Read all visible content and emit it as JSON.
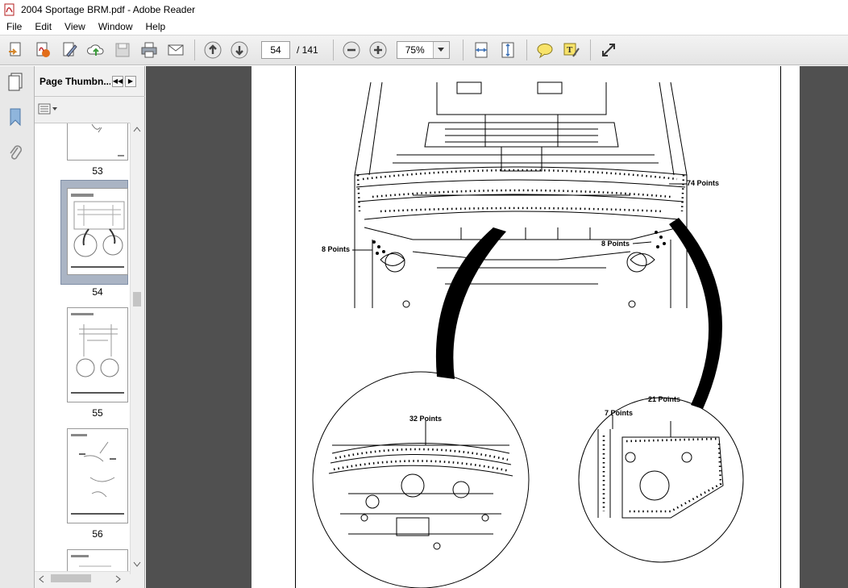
{
  "window": {
    "title": "2004 Sportage BRM.pdf - Adobe Reader"
  },
  "menu": [
    "File",
    "Edit",
    "View",
    "Window",
    "Help"
  ],
  "toolbar": {
    "page_current": "54",
    "page_total": "/ 141",
    "zoom": "75%"
  },
  "thumbnails": {
    "title": "Page Thumbn...",
    "pages": [
      "53",
      "54",
      "55",
      "56"
    ],
    "selected": "54"
  },
  "drawing": {
    "callouts": {
      "top_right": "74 Points",
      "left": "8 Points",
      "right": "8 Points",
      "zoom_left": "32 Points",
      "zoom_right_a": "21 Points",
      "zoom_right_b": "7 Points"
    }
  }
}
